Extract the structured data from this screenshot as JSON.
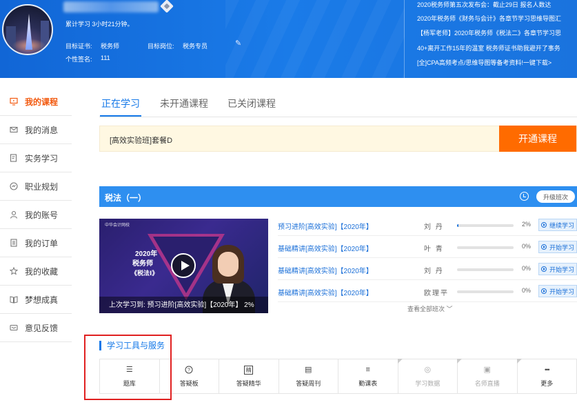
{
  "profile": {
    "study_time": "累计学习 3小时21分钟。",
    "cert_label": "目标证书:",
    "cert_value": "税务师",
    "post_label": "目标岗位:",
    "post_value": "税务专员",
    "sig_label": "个性签名:",
    "sig_value": "111"
  },
  "news": [
    "2020税务师第五次发布会：截止29日 报名人数达",
    "2020年税务师《财务与会计》各章节学习思维导图汇",
    "【杨军老师】2020年税务师《税法二》各章节学习思",
    "40+离开工作15年的温室 税务师证书助我避开了事务",
    "[全]CPA高频考点/思维导图等备考资料!一键下载>"
  ],
  "sidebar": [
    {
      "label": "我的课程",
      "icon": "monitor-icon",
      "active": true
    },
    {
      "label": "我的消息",
      "icon": "envelope-icon"
    },
    {
      "label": "实务学习",
      "icon": "document-edit-icon"
    },
    {
      "label": "职业规划",
      "icon": "compass-icon"
    },
    {
      "label": "我的账号",
      "icon": "user-icon"
    },
    {
      "label": "我的订单",
      "icon": "order-icon"
    },
    {
      "label": "我的收藏",
      "icon": "star-icon"
    },
    {
      "label": "梦想成真",
      "icon": "book-icon"
    },
    {
      "label": "意见反馈",
      "icon": "feedback-icon"
    }
  ],
  "tabs": [
    "正在学习",
    "未开通课程",
    "已关闭课程"
  ],
  "open_bar": {
    "package": "[高效实验班]套餐D",
    "button": "开通课程"
  },
  "course": {
    "name": "税法（一）",
    "upgrade": "升级班次",
    "thumb": {
      "brand": "中华会计网校",
      "year": "2020年",
      "line2": "税务师",
      "line3": "《税法Ⅰ》",
      "last_study": "上次学习到:  预习进阶[高效实验]【2020年】  2%"
    },
    "lessons": [
      {
        "title": "预习进阶[高效实验]【2020年】",
        "teacher": "刘 丹",
        "progress": 0.02,
        "pct": "2%",
        "action": "继续学习"
      },
      {
        "title": "基础精讲[高效实验]【2020年】",
        "teacher": "叶 青",
        "progress": 0,
        "pct": "0%",
        "action": "开始学习"
      },
      {
        "title": "基础精讲[高效实验]【2020年】",
        "teacher": "刘 丹",
        "progress": 0,
        "pct": "0%",
        "action": "开始学习"
      },
      {
        "title": "基础精讲[高效实验]【2020年】",
        "teacher": "欧理平",
        "progress": 0,
        "pct": "0%",
        "action": "开始学习"
      }
    ],
    "view_all": "查看全部班次 ﹀"
  },
  "tools": {
    "title": "学习工具与服务",
    "items": [
      {
        "label": "题库",
        "icon": "list-icon",
        "glyph": "☰"
      },
      {
        "label": "答疑板",
        "icon": "question-icon",
        "glyph": "?"
      },
      {
        "label": "答疑精华",
        "icon": "essence-icon",
        "glyph": "精"
      },
      {
        "label": "答疑周刊",
        "icon": "weekly-icon",
        "glyph": "▤"
      },
      {
        "label": "勤课表",
        "icon": "schedule-icon",
        "glyph": "≡"
      },
      {
        "label": "学习数据",
        "icon": "data-icon",
        "glyph": "◎",
        "disabled": true
      },
      {
        "label": "名师直播",
        "icon": "live-icon",
        "glyph": "▣",
        "disabled": true
      },
      {
        "label": "更多",
        "icon": "more-icon",
        "glyph": "•••"
      }
    ]
  },
  "colors": {
    "header_blue": "#1a73de",
    "accent_orange": "#ff6b00",
    "active_orange": "#f25a10",
    "link_blue": "#1478e8",
    "course_bar_blue": "#2e8ff0",
    "highlight_red": "#e02020"
  }
}
